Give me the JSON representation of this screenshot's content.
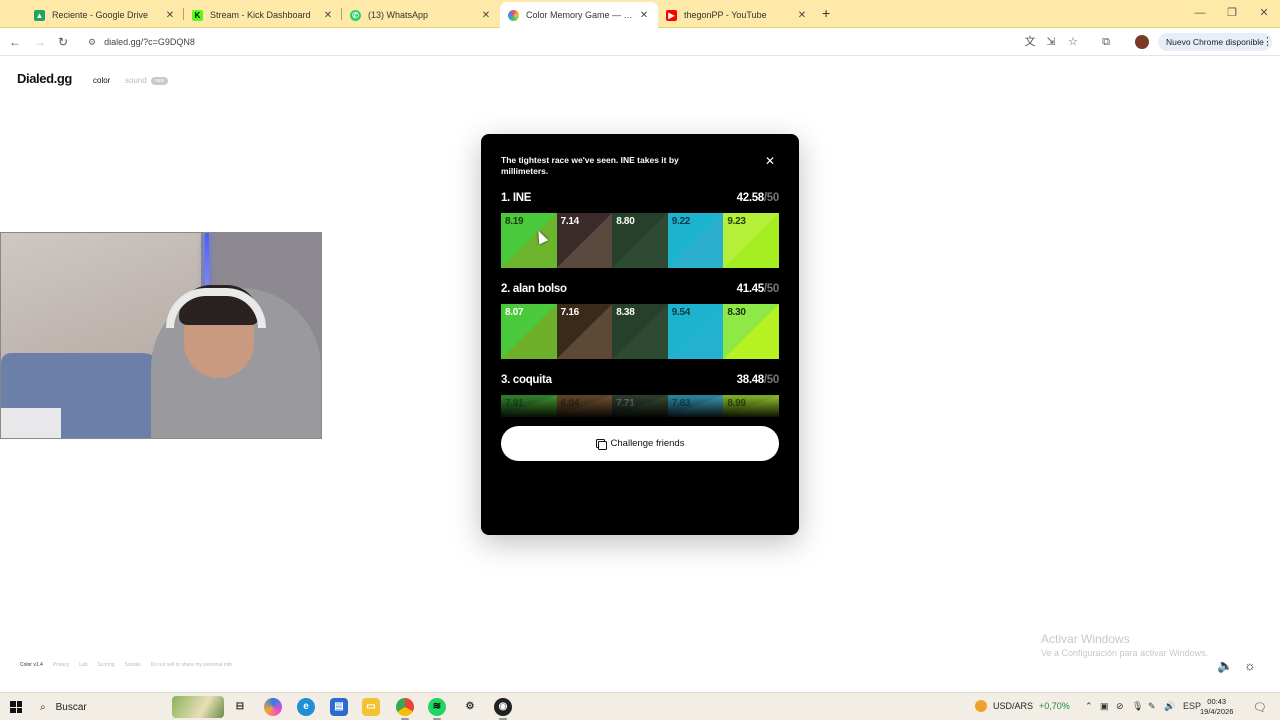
{
  "browser": {
    "tabs": [
      {
        "title": "Reciente - Google Drive",
        "icon": "google-drive-icon",
        "color": "#1fa463"
      },
      {
        "title": "Stream - Kick Dashboard",
        "icon": "kick-icon",
        "color": "#53fc18"
      },
      {
        "title": "(13) WhatsApp",
        "icon": "whatsapp-icon",
        "color": "#25d366"
      },
      {
        "title": "Color Memory Game — How W",
        "icon": "color-wheel-icon",
        "color": "#e94a7a",
        "active": true
      },
      {
        "title": "thegonPP - YouTube",
        "icon": "youtube-icon",
        "color": "#ff0000"
      }
    ],
    "url": "dialed.gg/?c=G9DQN8",
    "update_label": "Nuevo Chrome disponible"
  },
  "page": {
    "logo": "Dialed.gg",
    "nav_color": "color",
    "nav_sound": "sound",
    "nav_sound_badge": "new",
    "footer": {
      "version": "Color v1.4",
      "privacy": "Privacy",
      "lab": "Lab",
      "scoring": "Scoring",
      "socials": "Socials",
      "do_not_sell": "Do not sell or share my personal info"
    }
  },
  "modal": {
    "heading": "The tightest race we've seen. INE takes it by millimeters.",
    "close_icon": "close-icon",
    "players": [
      {
        "rank_name": "1. INE",
        "score": "42.58",
        "of": "/50",
        "swatches": [
          {
            "value": "8.19",
            "target": "#4bc93c",
            "guess": "#6db52c",
            "text": "#1a3b12"
          },
          {
            "value": "7.14",
            "target": "#3a2a2a",
            "guess": "#5a4a3e",
            "text": "#ffffff"
          },
          {
            "value": "8.80",
            "target": "#27402c",
            "guess": "#2f4a32",
            "text": "#ffffff"
          },
          {
            "value": "9.22",
            "target": "#1db3cf",
            "guess": "#2ab0cc",
            "text": "#0d3a44"
          },
          {
            "value": "9.23",
            "target": "#b4f03a",
            "guess": "#a6ee22",
            "text": "#2a3d08"
          }
        ]
      },
      {
        "rank_name": "2. alan bolso",
        "score": "41.45",
        "of": "/50",
        "swatches": [
          {
            "value": "8.07",
            "target": "#4bc93c",
            "guess": "#6fb02a",
            "text": "#ffffff"
          },
          {
            "value": "7.16",
            "target": "#3a2a1a",
            "guess": "#5e4a34",
            "text": "#ffffff"
          },
          {
            "value": "8.38",
            "target": "#27402c",
            "guess": "#2f4a32",
            "text": "#ffffff"
          },
          {
            "value": "9.54",
            "target": "#1db3cf",
            "guess": "#22b2d0",
            "text": "#0d3a44"
          },
          {
            "value": "8.30",
            "target": "#8ee845",
            "guess": "#b6f122",
            "text": "#1a2d08"
          }
        ]
      },
      {
        "rank_name": "3. coquita",
        "score": "38.48",
        "of": "/50",
        "swatches": [
          {
            "value": "7.91",
            "target": "#2e7a2c",
            "guess": "#3f8a2a",
            "text": "#1a3b12"
          },
          {
            "value": "6.04",
            "target": "#5a4226",
            "guess": "#6a4d2e",
            "text": "#2a1a0e"
          },
          {
            "value": "7.71",
            "target": "#2a3a2c",
            "guess": "#34452f",
            "text": "#888888"
          },
          {
            "value": "7.83",
            "target": "#2a7f96",
            "guess": "#3a8da3",
            "text": "#0d3a44"
          },
          {
            "value": "8.99",
            "target": "#7aa825",
            "guess": "#8bb52a",
            "text": "#1a2d08"
          }
        ]
      }
    ],
    "challenge_label": "Challenge friends"
  },
  "watermark": {
    "line1": "Activar Windows",
    "line2": "Ve a Configuración para activar Windows."
  },
  "taskbar": {
    "search_label": "Buscar",
    "stock_label": "USD/ARS",
    "stock_change": "+0,70%",
    "lang": "ESP",
    "time": "00:43",
    "date": "19/4/2026"
  }
}
